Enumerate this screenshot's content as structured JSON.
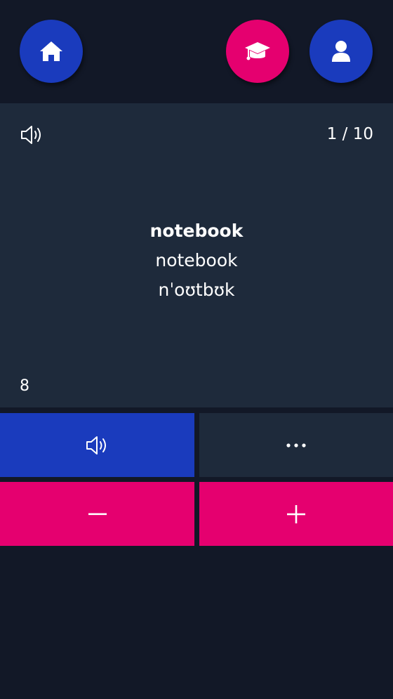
{
  "header": {
    "home_icon": "home-icon",
    "learn_icon": "graduation-cap-icon",
    "profile_icon": "user-icon"
  },
  "card": {
    "speaker_icon": "speaker-icon",
    "counter": "1 / 10",
    "word": "notebook",
    "translation": "notebook",
    "transcription": "nˈoʊtbʊk",
    "score": "8"
  },
  "actions": {
    "speak_icon": "speaker-icon",
    "more_icon": "more-dots-icon",
    "minus_label": "−",
    "plus_label": "+"
  },
  "colors": {
    "background": "#121827",
    "card": "#1e2a3b",
    "primary_blue": "#1a3bbd",
    "accent_pink": "#e5006f",
    "text": "#ffffff"
  }
}
